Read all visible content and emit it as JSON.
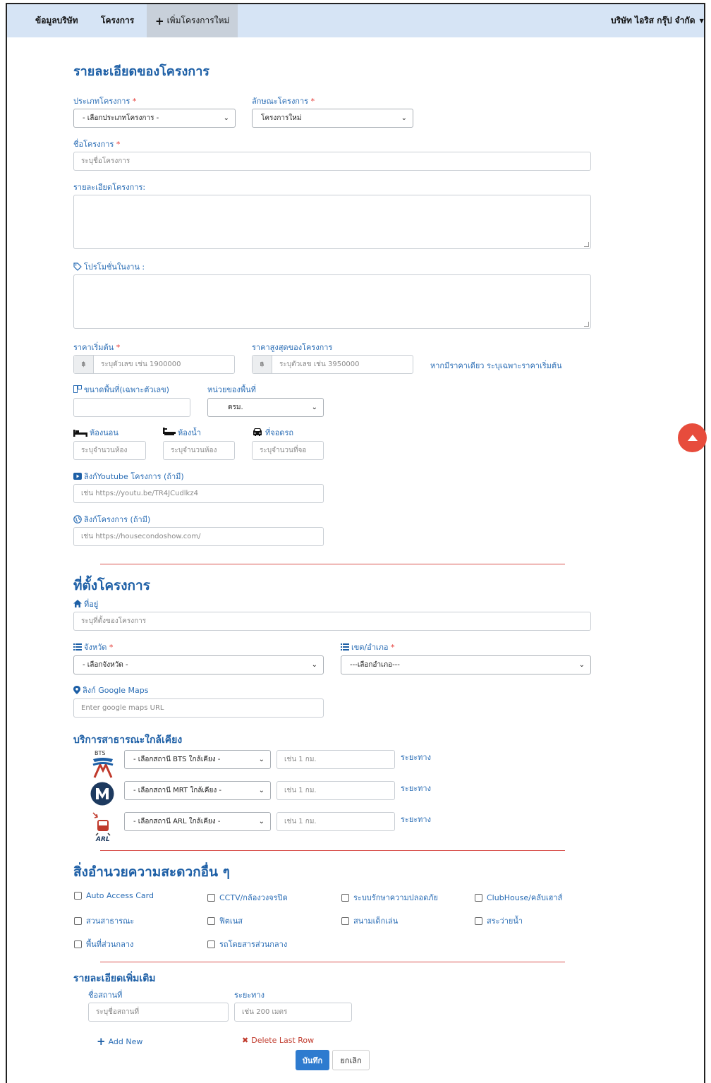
{
  "nav": {
    "company_info": "ข้อมูลบริษัท",
    "projects": "โครงการ",
    "add_project": "เพิ่มโครงการใหม่",
    "company_name": "บริษัท ไอริส กรุ๊ป จำกัด"
  },
  "details": {
    "title": "รายละเอียดของโครงการ",
    "project_type_label": "ประเภทโครงการ",
    "project_type_value": "- เลือกประเภทโครงการ -",
    "project_nature_label": "ลักษณะโครงการ",
    "project_nature_value": "โครงการใหม่",
    "name_label": "ชื่อโครงการ",
    "name_placeholder": "ระบุชื่อโครงการ",
    "desc_label": "รายละเอียดโครงการ:",
    "promo_label": "โปรโมชั่นในงาน :",
    "price_start_label": "ราคาเริ่มต้น",
    "price_start_placeholder": "ระบุตัวเลข เช่น 1900000",
    "price_max_label": "ราคาสูงสุดของโครงการ",
    "price_max_placeholder": "ระบุตัวเลข เช่น 3950000",
    "currency": "฿",
    "price_hint": "หากมีราคาเดียว ระบุเฉพาะราคาเริ่มต้น",
    "area_label": "ขนาดพื้นที่(เฉพาะตัวเลข)",
    "area_unit_label": "หน่วยของพื้นที่",
    "area_unit_value": "ตรม.",
    "bedroom_label": "ห้องนอน",
    "bedroom_placeholder": "ระบุจำนวนห้อง",
    "bathroom_label": "ห้องน้ำ",
    "bathroom_placeholder": "ระบุจำนวนห้อง",
    "parking_label": "ที่จอดรถ",
    "parking_placeholder": "ระบุจำนวนที่จอ",
    "youtube_label": "ลิงก์Youtube โครงการ (ถ้ามี)",
    "youtube_placeholder": "เช่น https://youtu.be/TR4JCudlkz4",
    "website_label": "ลิงก์โครงการ (ถ้ามี)",
    "website_placeholder": "เช่น https://housecondoshow.com/"
  },
  "location": {
    "title": "ที่ตั้งโครงการ",
    "address_label": "ที่อยู่",
    "address_placeholder": "ระบุที่ตั้งของโครงการ",
    "province_label": "จังหวัด",
    "province_value": "- เลือกจังหวัด -",
    "district_label": "เขต/อำเภอ",
    "district_value": "---เลือกอำเภอ---",
    "maps_label": "ลิงก์ Google Maps",
    "maps_placeholder": "Enter google maps URL"
  },
  "transit": {
    "title": "บริการสาธารณะใกล้เคียง",
    "bts_logo_text": "BTS",
    "arl_logo_text": "ARL",
    "rows": [
      {
        "select": "- เลือกสถานี BTS ใกล้เคียง -",
        "placeholder": "เช่น 1 กม.",
        "hint": "ระยะทาง"
      },
      {
        "select": "- เลือกสถานี MRT ใกล้เคียง -",
        "placeholder": "เช่น 1 กม.",
        "hint": "ระยะทาง"
      },
      {
        "select": "- เลือกสถานี ARL ใกล้เคียง -",
        "placeholder": "เช่น 1 กม.",
        "hint": "ระยะทาง"
      }
    ]
  },
  "facilities": {
    "title": "สิ่งอำนวยความสะดวกอื่น ๆ",
    "items": [
      "Auto Access Card",
      "CCTV/กล้องวงจรปิด",
      "ระบบรักษาความปลอดภัย",
      "ClubHouse/คลับเฮาส์",
      "สวนสาธารณะ",
      "ฟิตเนส",
      "สนามเด็กเล่น",
      "สระว่ายน้ำ",
      "พื้นที่ส่วนกลาง",
      "รถโดยสารส่วนกลาง"
    ]
  },
  "extra": {
    "title": "รายละเอียดเพิ่มเติม",
    "place_label": "ชื่อสถานที่",
    "place_placeholder": "ระบุชื่อสถานที่",
    "distance_label": "ระยะทาง",
    "distance_placeholder": "เช่น 200 เมตร",
    "add_new": "Add New",
    "delete_last": "Delete Last Row"
  },
  "actions": {
    "save": "บันทึก",
    "cancel": "ยกเลิก"
  },
  "colors": {
    "primary": "#1d5fa6",
    "danger": "#d9534f",
    "save_button": "#2e7bcf",
    "scroll_top": "#e74c3c"
  }
}
